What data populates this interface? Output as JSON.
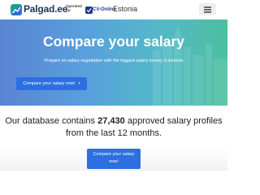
{
  "header": {
    "logo_text": "Palgad.ee",
    "operated_by": "Operated by:",
    "operator_name": "CV-Online",
    "country": "Estonia",
    "menu_icon": "hamburger-menu-icon"
  },
  "hero": {
    "title": "Compare your salary",
    "subtitle": "Prepare on salary negotiation with the biggest salary survey in Estonia",
    "cta_label": "Compare your salary now!",
    "cta_icon": "chevron-right-icon"
  },
  "stats": {
    "prefix": "Our database contains",
    "count": "27,430",
    "suffix": "approved salary profiles from the last 12 months."
  },
  "bottom_cta": {
    "line1": "Compare your salary",
    "line2": "now!"
  },
  "colors": {
    "brand_navy": "#1d3557",
    "cta_blue": "#2d6fe0",
    "hero_gradient_start": "#5a84d2",
    "hero_gradient_end": "#4cbf9f"
  }
}
